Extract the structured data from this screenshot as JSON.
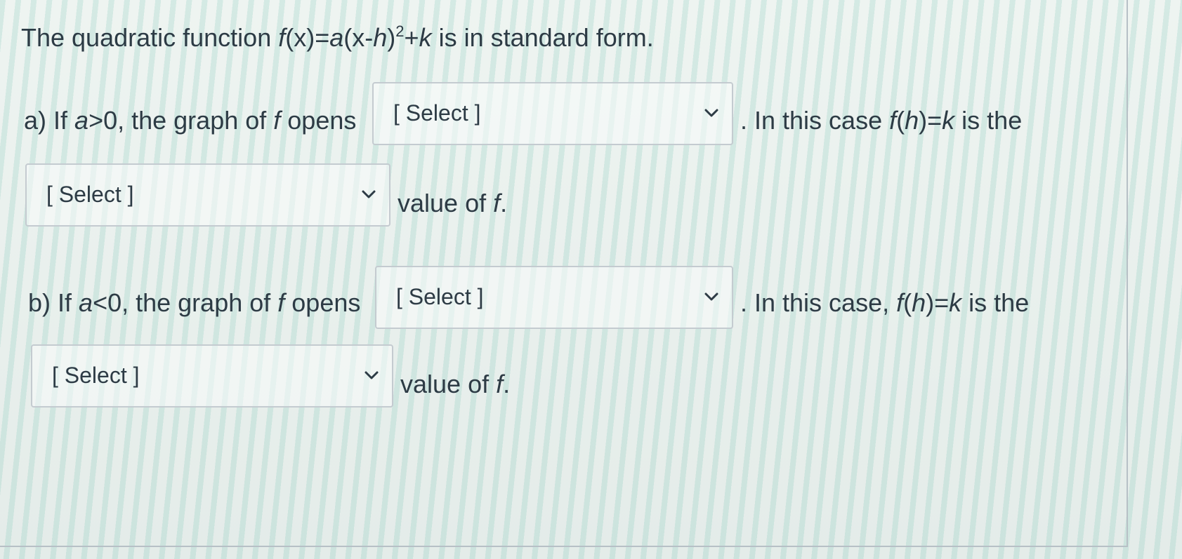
{
  "question": {
    "stem": {
      "prefix": "The quadratic function ",
      "formula_fx": "f",
      "formula_x": "(x)=",
      "formula_a": "a",
      "formula_body": "(x-",
      "formula_h": "h",
      "formula_close": ")",
      "formula_exp": "2",
      "formula_plus": "+",
      "formula_k": "k",
      "suffix": " is in standard form."
    },
    "part_a": {
      "lead": "a) If ",
      "var_a": "a",
      "condition": ">0, the graph of ",
      "var_f": "f",
      "opens": " opens",
      "select_1": "[ Select ]",
      "after_1_prefix": ". In this case ",
      "fh_f": "f",
      "fh_paren_open": "(",
      "fh_h": "h",
      "fh_eq": ")=",
      "fh_k": "k",
      "after_1_suffix": " is the",
      "select_2": "[ Select ]",
      "tail_prefix": "value of ",
      "tail_f": "f",
      "tail_dot": "."
    },
    "part_b": {
      "lead": "b) If ",
      "var_a": "a",
      "condition": "<0, the graph of ",
      "var_f": "f",
      "opens": " opens",
      "select_1": "[ Select ]",
      "after_1_prefix": ". In this case, ",
      "fh_f": "f",
      "fh_paren_open": "(",
      "fh_h": "h",
      "fh_eq": ")=",
      "fh_k": "k",
      "after_1_suffix": " is the",
      "select_2": "[ Select ]",
      "tail_prefix": "value of ",
      "tail_f": "f",
      "tail_dot": "."
    }
  },
  "icons": {
    "dropdown": "chevron-down-icon"
  },
  "colors": {
    "text": "#2d3b45",
    "border": "#c4cbd0"
  }
}
